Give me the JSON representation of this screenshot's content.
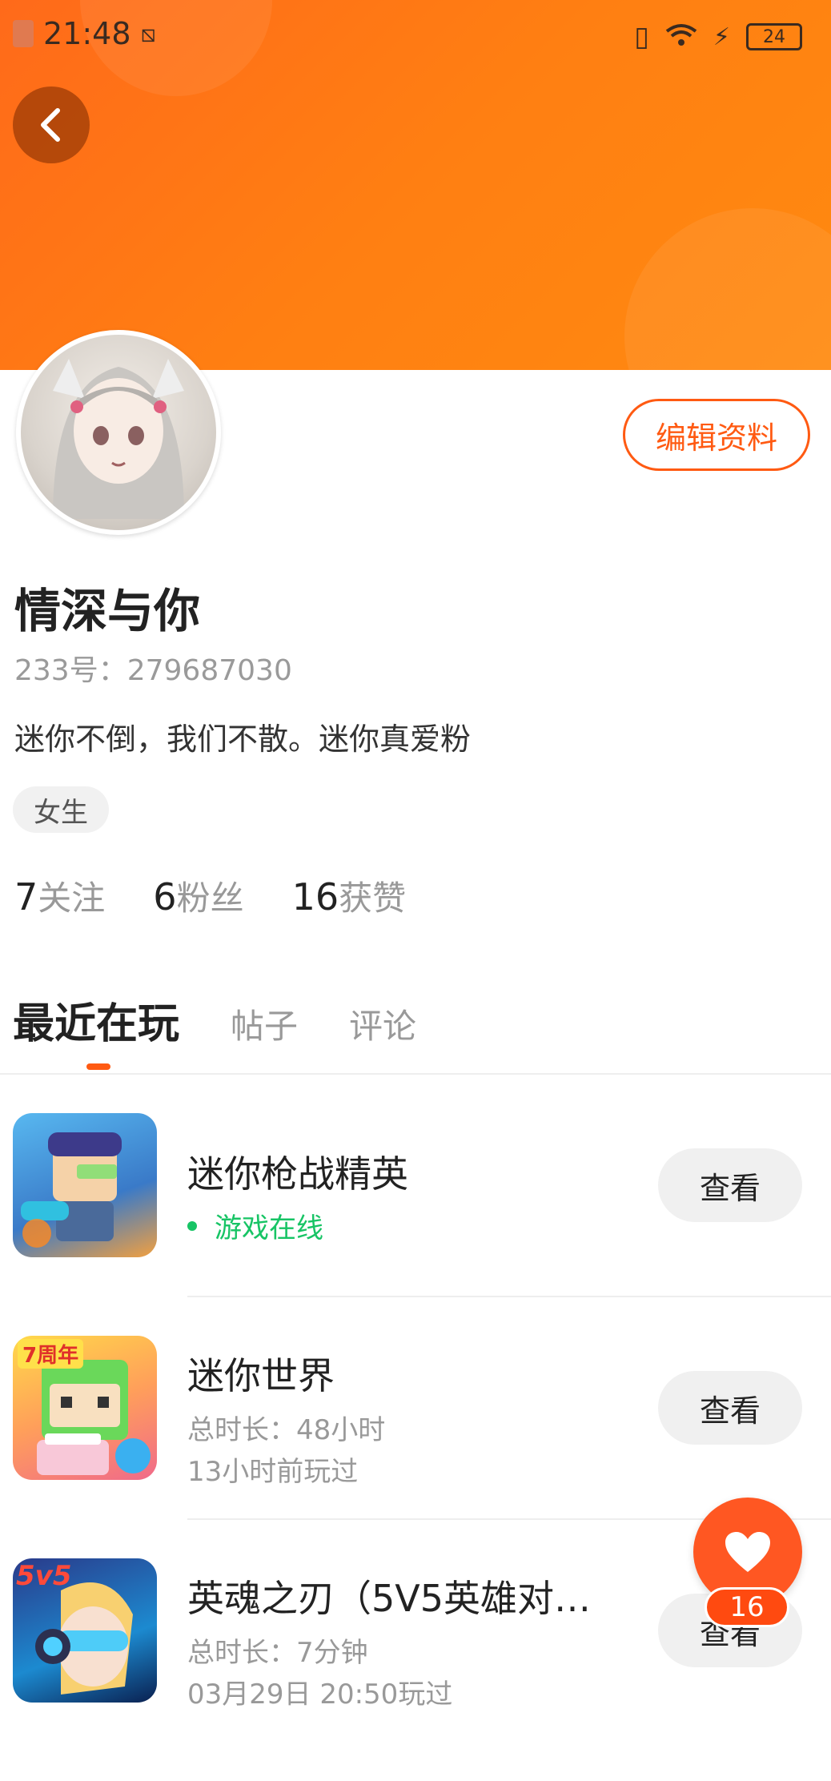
{
  "status_bar": {
    "time": "21:48",
    "battery": "24"
  },
  "profile": {
    "name": "情深与你",
    "id_label": "233号：",
    "id_value": "279687030",
    "bio": "迷你不倒，我们不散。迷你真爱粉",
    "gender_tag": "女生",
    "edit_button": "编辑资料"
  },
  "stats": [
    {
      "count": "7",
      "label": "关注"
    },
    {
      "count": "6",
      "label": "粉丝"
    },
    {
      "count": "16",
      "label": "获赞"
    }
  ],
  "tabs": [
    {
      "label": "最近在玩",
      "active": true
    },
    {
      "label": "帖子",
      "active": false
    },
    {
      "label": "评论",
      "active": false
    }
  ],
  "games": [
    {
      "title": "迷你枪战精英",
      "status": "游戏在线",
      "button": "查看"
    },
    {
      "title": "迷你世界",
      "duration": "总时长：48小时",
      "last_played": "13小时前玩过",
      "button": "查看"
    },
    {
      "title": "英魂之刃（5V5英雄对…",
      "duration": "总时长：7分钟",
      "last_played": "03月29日 20:50玩过",
      "button": "查看",
      "icon_text": "5v5"
    }
  ],
  "game_icon_labels": {
    "anniversary": "7周年"
  },
  "like": {
    "count": "16"
  },
  "colors": {
    "header": "#ff7a14",
    "accent": "#ff5a12",
    "online": "#17c465"
  }
}
